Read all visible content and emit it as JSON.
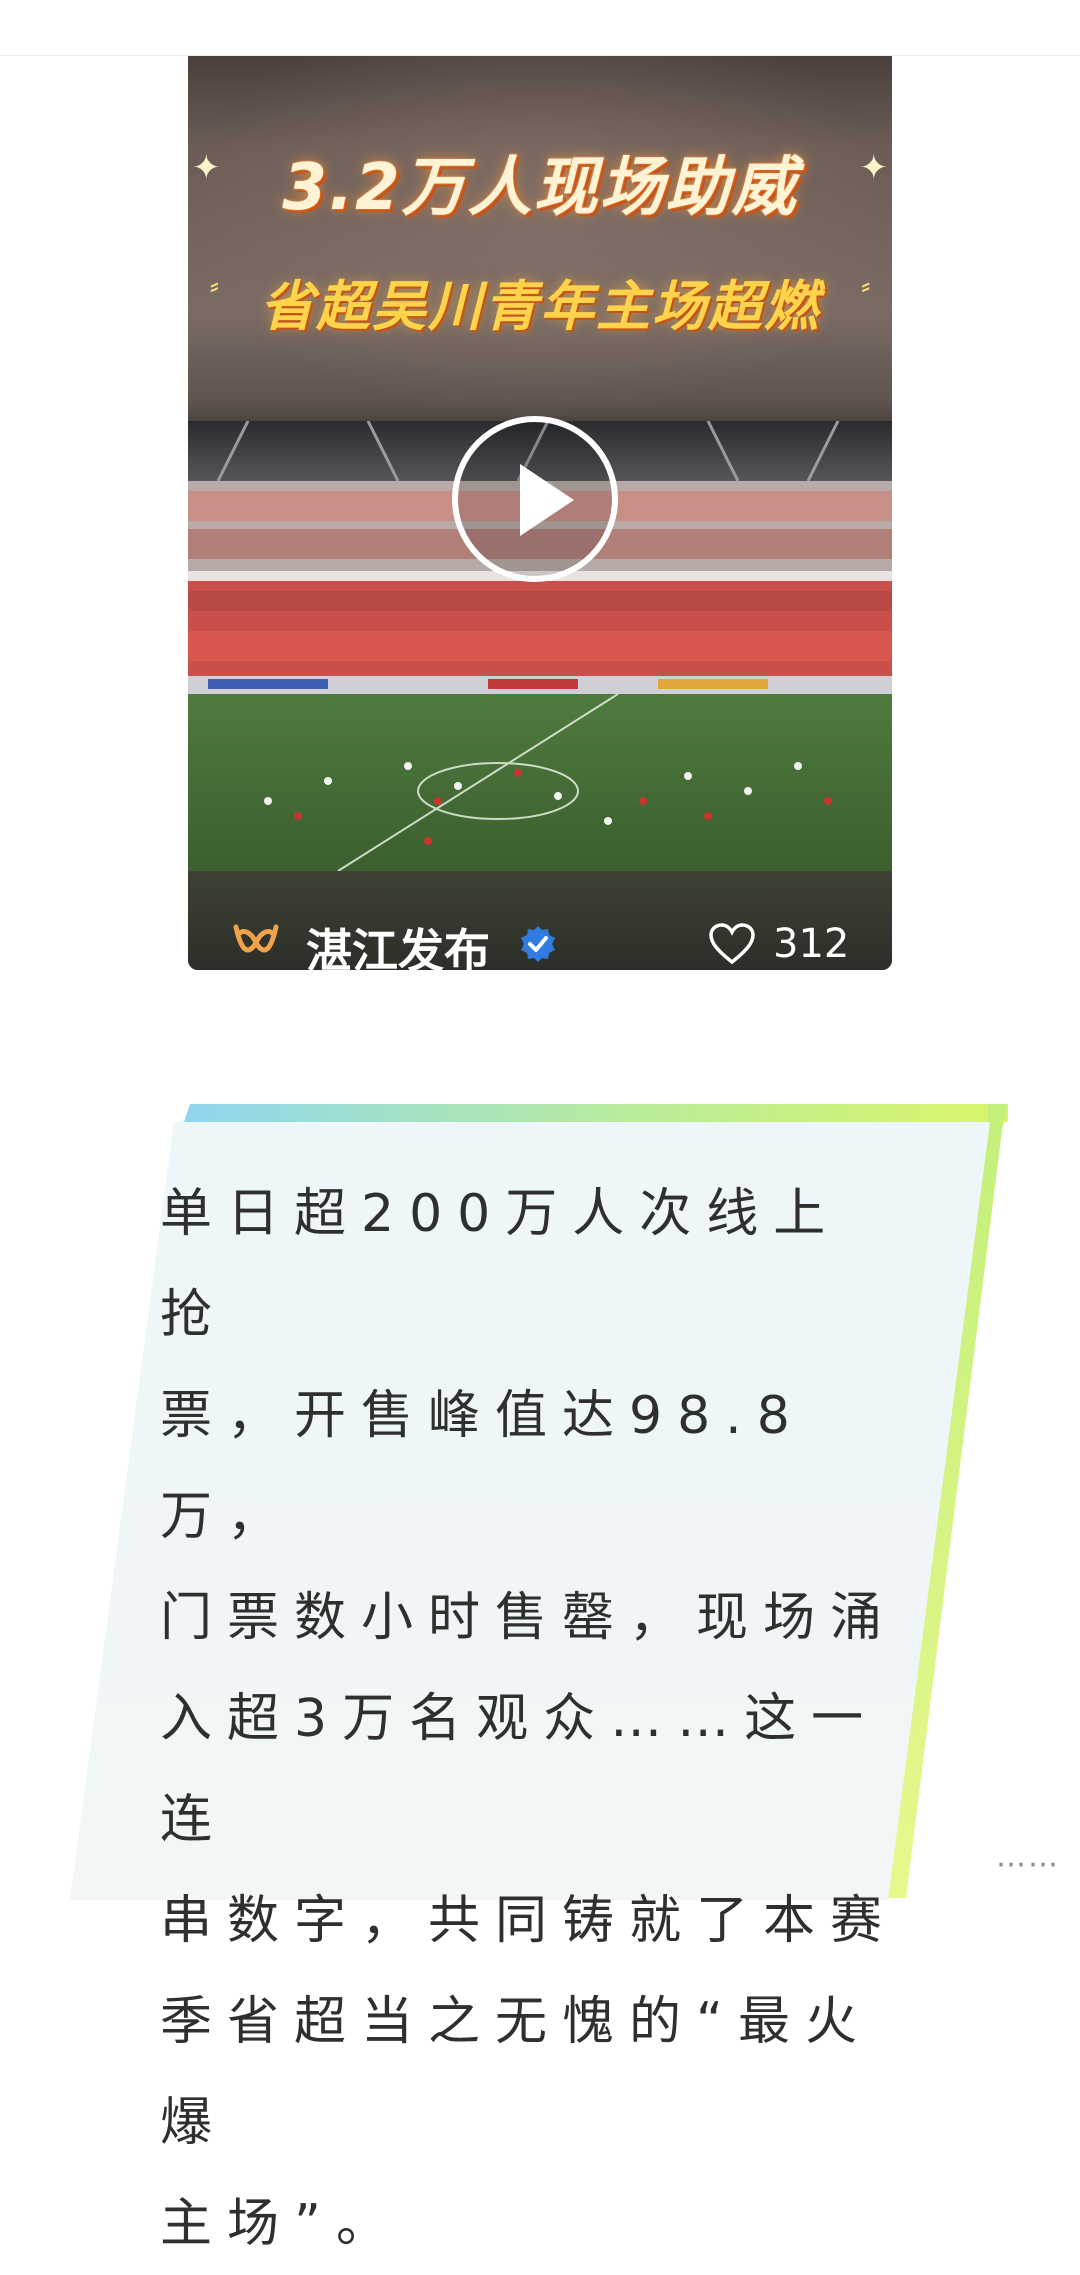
{
  "video_card": {
    "headline_1": "3.2万人现场助威",
    "headline_2": "省超吴川青年主场超燃",
    "source_name": "湛江发布",
    "like_count": "312",
    "icons": [
      "brand-logo-icon",
      "verified-badge-icon",
      "heart-icon",
      "play-icon"
    ],
    "colors": {
      "headline_gold": "#ffd34a",
      "logo_orange": "#f0a24a",
      "verified_blue": "#2f7de1"
    }
  },
  "article": {
    "paragraph": "单日超200万人次线上抢\n票，开售峰值达98.8万，\n门票数小时售罄，现场涌\n入超3万名观众……这一连\n串数字，共同铸就了本赛\n季省超当之无愧的“最火爆\n主场”。"
  },
  "watermark": {
    "icon": "menu-dots-icon",
    "glyph": "⋯⋯"
  }
}
